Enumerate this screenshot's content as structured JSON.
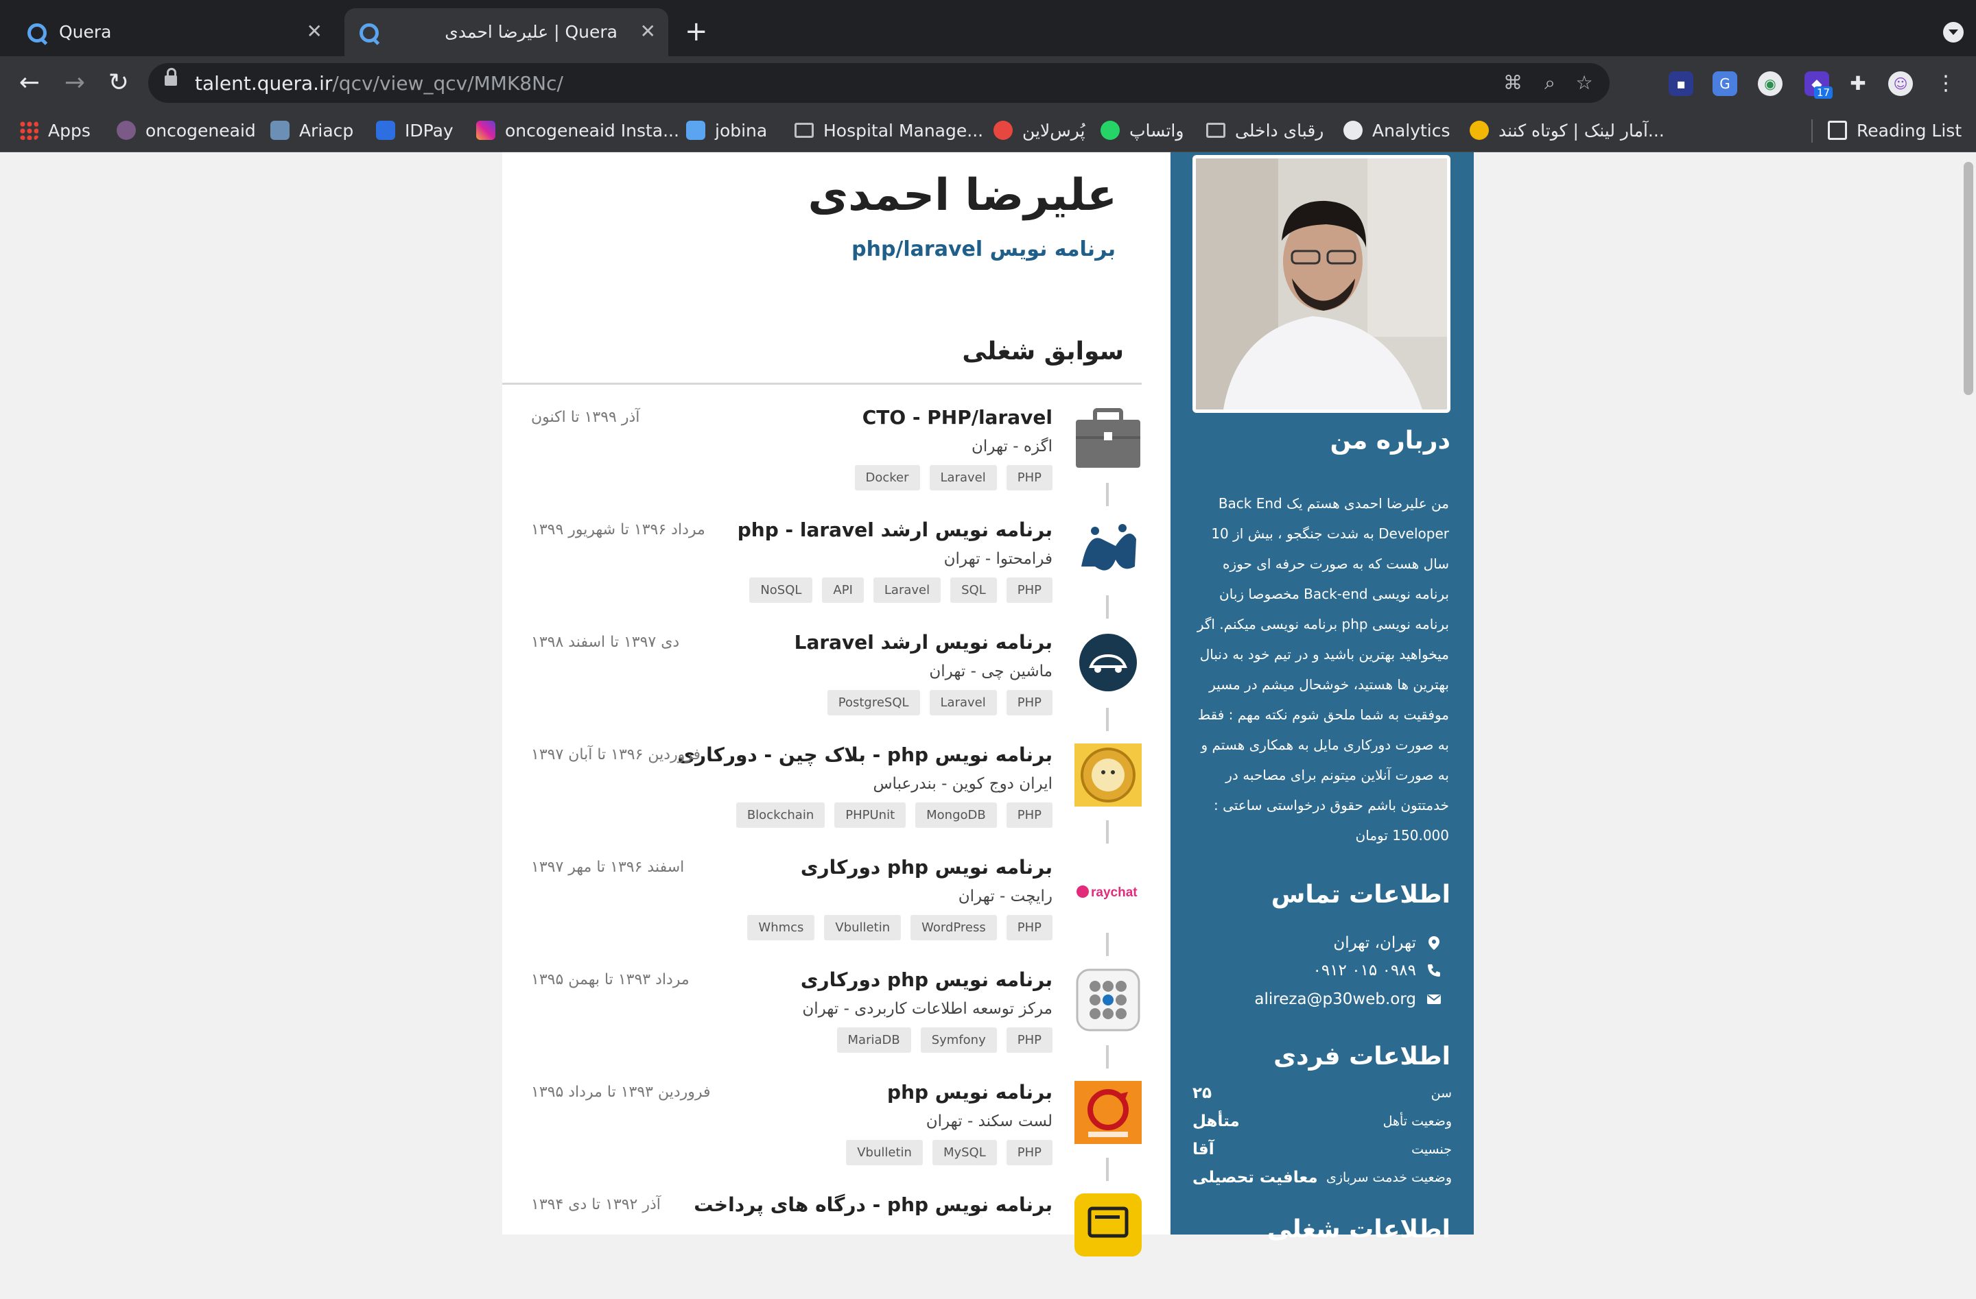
{
  "browser": {
    "tabs": [
      {
        "title": "Quera",
        "active": false
      },
      {
        "title": "علیرضا احمدی | Quera",
        "active": true
      }
    ],
    "url_host": "talent.quera.ir",
    "url_path": "/qcv/view_qcv/MMK8Nc/",
    "extension_badge": "17",
    "bookmarks": [
      {
        "label": "Apps"
      },
      {
        "label": "oncogeneaid"
      },
      {
        "label": "Ariacp"
      },
      {
        "label": "IDPay"
      },
      {
        "label": "oncogeneaid Insta..."
      },
      {
        "label": "jobina"
      },
      {
        "label": "Hospital Manage..."
      },
      {
        "label": "پُرس‌لاین"
      },
      {
        "label": "واتساپ"
      },
      {
        "label": "رقبای داخلی"
      },
      {
        "label": "Analytics"
      },
      {
        "label": "آمار لینک | کوتاه کنند..."
      },
      {
        "label": "Reading List"
      }
    ]
  },
  "profile": {
    "name": "علیرضا احمدی",
    "title": "برنامه نویس php/laravel"
  },
  "experience": {
    "heading": "سوابق شغلی",
    "jobs": [
      {
        "title": "CTO - PHP/laravel",
        "company": "اگزه - تهران",
        "date": "آذر ۱۳۹۹ تا اکنون",
        "tags": [
          "PHP",
          "Laravel",
          "Docker"
        ],
        "logo": "briefcase-icon"
      },
      {
        "title": "برنامه نویس ارشد php - laravel",
        "company": "فرامحتوا - تهران",
        "date": "مرداد ۱۳۹۶ تا شهریور ۱۳۹۹",
        "tags": [
          "PHP",
          "SQL",
          "Laravel",
          "API",
          "NoSQL"
        ],
        "logo": "faramohtava-logo"
      },
      {
        "title": "برنامه نویس ارشد Laravel",
        "company": "ماشین چی - تهران",
        "date": "دی ۱۳۹۷ تا اسفند ۱۳۹۸",
        "tags": [
          "PHP",
          "Laravel",
          "PostgreSQL"
        ],
        "logo": "machinchi-logo"
      },
      {
        "title": "برنامه نویس php - بلاک چین - دورکاری",
        "company": "ایران دوج کوین - بندرعباس",
        "date": "فروردین ۱۳۹۶ تا آبان ۱۳۹۷",
        "tags": [
          "PHP",
          "MongoDB",
          "PHPUnit",
          "Blockchain"
        ],
        "logo": "dogecoin-logo"
      },
      {
        "title": "برنامه نویس php دورکاری",
        "company": "رایچت - تهران",
        "date": "اسفند ۱۳۹۶ تا مهر ۱۳۹۷",
        "tags": [
          "PHP",
          "WordPress",
          "Vbulletin",
          "Whmcs"
        ],
        "logo": "raychat-logo"
      },
      {
        "title": "برنامه نویس php دورکاری",
        "company": "مرکز توسعه اطلاعات کاربردی - تهران",
        "date": "مرداد ۱۳۹۳ تا بهمن ۱۳۹۵",
        "tags": [
          "PHP",
          "Symfony",
          "MariaDB"
        ],
        "logo": "apps-grid-logo"
      },
      {
        "title": "برنامه نویس php",
        "company": "لست سکند - تهران",
        "date": "فروردین ۱۳۹۳ تا مرداد ۱۳۹۵",
        "tags": [
          "PHP",
          "MySQL",
          "Vbulletin"
        ],
        "logo": "lastsecond-logo"
      },
      {
        "title": "برنامه نویس php - درگاه های پرداخت",
        "company": "",
        "date": "آذر ۱۳۹۲ تا دی ۱۳۹۴",
        "tags": [],
        "logo": "payment-logo"
      }
    ]
  },
  "sidebar": {
    "raychat_logo_text": "raychat",
    "about_heading": "درباره من",
    "about_text": "من علیرضا احمدی هستم یک Back End Developer به شدت جنگجو ، بیش از 10 سال هست که به صورت حرفه ای حوزه برنامه نویسی Back-end مخصوصا زبان برنامه نویسی php برنامه نویسی میکنم. اگر میخواهید بهترین باشید و در تیم خود به دنبال بهترین ها هستید، خوشحال میشم در مسیر موفقیت به شما ملحق شوم نکته مهم : فقط به صورت دورکاری مایل به همکاری هستم و به صورت آنلاین میتونم برای مصاحبه در خدمتتون باشم حقوق درخواستی ساعتی : 150.000 تومان",
    "contact_heading": "اطلاعات تماس",
    "contact": {
      "location": "تهران، تهران",
      "phone": "۰۹۱۲ ۰۱۵ ۰۹۸۹",
      "email": "alireza@p30web.org"
    },
    "personal_heading": "اطلاعات فردی",
    "personal": [
      {
        "key": "سن",
        "value": "۲۵"
      },
      {
        "key": "وضعیت تأهل",
        "value": "متأهل"
      },
      {
        "key": "جنسیت",
        "value": "آقا"
      },
      {
        "key": "وضعیت خدمت سربازی",
        "value": "معافیت تحصیلی"
      }
    ],
    "next_heading": "اطلاعات شغلی"
  }
}
